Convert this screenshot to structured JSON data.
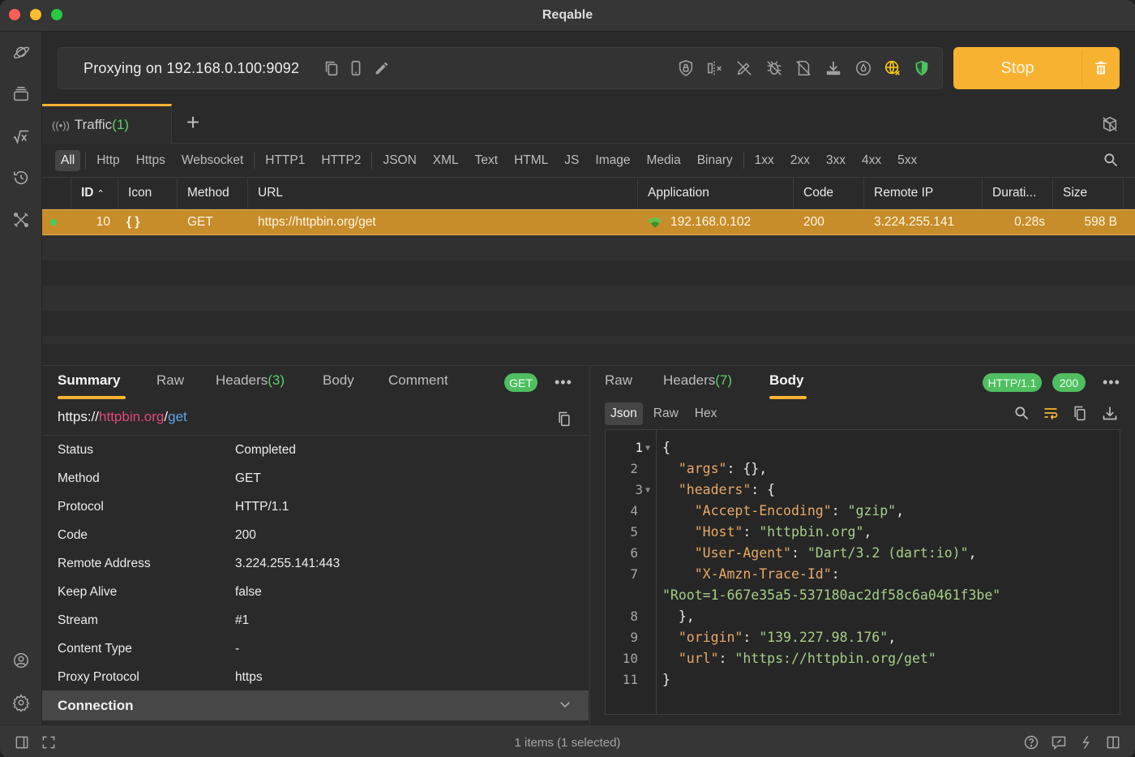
{
  "window": {
    "title": "Reqable"
  },
  "sidebar": {
    "items": [
      {
        "name": "capture",
        "icon": "planet-icon"
      },
      {
        "name": "collections",
        "icon": "stack-icon"
      },
      {
        "name": "toolbox",
        "icon": "sqrt-x-icon"
      },
      {
        "name": "history",
        "icon": "history-icon"
      },
      {
        "name": "tools",
        "icon": "wrench-screwdriver-icon"
      }
    ],
    "bottom": [
      {
        "name": "account",
        "icon": "user-circle-icon"
      },
      {
        "name": "settings",
        "icon": "gear-icon"
      }
    ]
  },
  "proxy": {
    "status_text": "Proxying on 192.168.0.100:9092",
    "icons": [
      "copy-icon",
      "phone-icon",
      "edit-icon",
      "ssl-lock-shield-icon",
      "breakpoint-off-icon",
      "rewrite-off-icon",
      "debug-off-icon",
      "script-off-icon",
      "download-icon",
      "throttle-icon",
      "globe-proxy-icon",
      "shield-check-icon"
    ],
    "stop_label": "Stop",
    "accent": "#f8b232"
  },
  "tabs": [
    {
      "label": "Traffic",
      "count": "(1)"
    }
  ],
  "filters": {
    "groups": [
      [
        "All",
        "Http",
        "Https",
        "Websocket"
      ],
      [
        "HTTP1",
        "HTTP2"
      ],
      [
        "JSON",
        "XML",
        "Text",
        "HTML",
        "JS",
        "Image",
        "Media",
        "Binary"
      ],
      [
        "1xx",
        "2xx",
        "3xx",
        "4xx",
        "5xx"
      ]
    ],
    "active": "All"
  },
  "table": {
    "columns": [
      "ID",
      "Icon",
      "Method",
      "URL",
      "Application",
      "Code",
      "Remote IP",
      "Durati...",
      "Size"
    ],
    "sort_indicator": "^",
    "rows": [
      {
        "id": "10",
        "icon": "{ }",
        "method": "GET",
        "url": "https://httpbin.org/get",
        "application": "192.168.0.102",
        "code": "200",
        "remote_ip": "3.224.255.141",
        "duration": "0.28s",
        "size": "598 B",
        "selected": true
      }
    ]
  },
  "request_panel": {
    "tabs": [
      {
        "label": "Summary",
        "active": true
      },
      {
        "label": "Raw"
      },
      {
        "label": "Headers",
        "count": "(3)"
      },
      {
        "label": "Body"
      },
      {
        "label": "Comment"
      }
    ],
    "method_badge": "GET",
    "url": {
      "scheme": "https://",
      "host": "httpbin.org",
      "slash": "/",
      "path": "get"
    },
    "summary": [
      {
        "key": "Status",
        "value": "Completed"
      },
      {
        "key": "Method",
        "value": "GET"
      },
      {
        "key": "Protocol",
        "value": "HTTP/1.1"
      },
      {
        "key": "Code",
        "value": "200"
      },
      {
        "key": "Remote Address",
        "value": "3.224.255.141:443"
      },
      {
        "key": "Keep Alive",
        "value": "false"
      },
      {
        "key": "Stream",
        "value": "#1"
      },
      {
        "key": "Content Type",
        "value": "-"
      },
      {
        "key": "Proxy Protocol",
        "value": "https"
      }
    ],
    "section": "Connection"
  },
  "response_panel": {
    "tabs": [
      {
        "label": "Raw"
      },
      {
        "label": "Headers",
        "count": "(7)"
      },
      {
        "label": "Body",
        "active": true
      }
    ],
    "protocol_badge": "HTTP/1.1",
    "code_badge": "200",
    "subtabs": [
      "Json",
      "Raw",
      "Hex"
    ],
    "active_subtab": "Json",
    "body_lines": [
      {
        "n": "1",
        "fold": true
      },
      {
        "n": "2"
      },
      {
        "n": "3",
        "fold": true
      },
      {
        "n": "4"
      },
      {
        "n": "5"
      },
      {
        "n": "6"
      },
      {
        "n": "7"
      },
      {
        "n": ""
      },
      {
        "n": "8"
      },
      {
        "n": "9"
      },
      {
        "n": "10"
      },
      {
        "n": "11"
      }
    ],
    "json": {
      "open": "{",
      "args_key": "\"args\"",
      "args_val": "{},",
      "headers_key": "\"headers\"",
      "headers_open": "{",
      "ae_key": "\"Accept-Encoding\"",
      "ae_val": "\"gzip\"",
      "host_key": "\"Host\"",
      "host_val": "\"httpbin.org\"",
      "ua_key": "\"User-Agent\"",
      "ua_val": "\"Dart/3.2 (dart:io)\"",
      "trace_key": "\"X-Amzn-Trace-Id\"",
      "trace_val": "\"Root=1-667e35a5-537180ac2df58c6a0461f3be\"",
      "headers_close": "},",
      "origin_key": "\"origin\"",
      "origin_val": "\"139.227.98.176\"",
      "url_key": "\"url\"",
      "url_val": "\"https://httpbin.org/get\"",
      "close": "}"
    }
  },
  "statusbar": {
    "text": "1 items (1 selected)"
  }
}
